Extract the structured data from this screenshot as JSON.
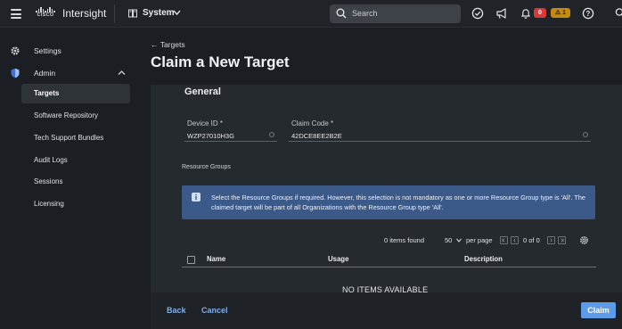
{
  "topbar": {
    "logo_word": "CISCO",
    "brand": "Intersight",
    "scope": "System",
    "search_placeholder": "Search",
    "critical_count": "0",
    "warning_count": "1"
  },
  "sidebar": {
    "items": [
      {
        "label": "Settings",
        "icon": "gear-icon"
      },
      {
        "label": "Admin",
        "icon": "shield-icon",
        "expanded": true
      }
    ],
    "admin_children": [
      {
        "label": "Targets",
        "active": true
      },
      {
        "label": "Software Repository"
      },
      {
        "label": "Tech Support Bundles"
      },
      {
        "label": "Audit Logs"
      },
      {
        "label": "Sessions"
      },
      {
        "label": "Licensing"
      }
    ]
  },
  "header": {
    "back_label": "← Targets",
    "title": "Claim a New Target"
  },
  "form": {
    "section_title": "General",
    "device_id_label": "Device ID *",
    "device_id_value": "WZP27010H3G",
    "claim_code_label": "Claim Code *",
    "claim_code_value": "42DCE8EE2B2E",
    "resource_groups_label": "Resource Groups",
    "info_text": "Select the Resource Groups if required. However, this selection is not mandatory as one or more Resource Group type is 'All'. The claimed target will be part of all Organizations with the Resource Group type 'All'."
  },
  "table": {
    "items_found": "0 items found",
    "page_size": "50",
    "per_page": "per page",
    "page_of": "0 of 0",
    "columns": [
      "Name",
      "Usage",
      "Description"
    ],
    "empty_text": "NO ITEMS AVAILABLE"
  },
  "footer": {
    "back": "Back",
    "cancel": "Cancel",
    "claim": "Claim"
  },
  "colors": {
    "accent": "#5b9be8",
    "info_bg": "#3b5a8a",
    "critical": "#d83a3a",
    "warning": "#c48a12"
  }
}
